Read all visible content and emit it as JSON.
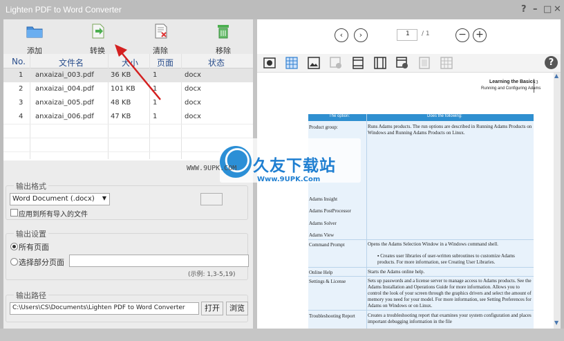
{
  "window": {
    "title": "Lighten PDF to Word Converter",
    "controls": [
      "?",
      "–",
      "□",
      "✕"
    ]
  },
  "toolbar": {
    "add": "添加",
    "convert": "转换",
    "clear": "清除",
    "remove": "移除"
  },
  "table": {
    "headers": [
      "No.",
      "文件名",
      "大小",
      "页面",
      "状态"
    ],
    "rows": [
      [
        "1",
        "anxaizai_003.pdf",
        "36 KB",
        "1",
        "docx"
      ],
      [
        "2",
        "anxaizai_004.pdf",
        "101 KB",
        "1",
        "docx"
      ],
      [
        "3",
        "anxaizai_005.pdf",
        "48 KB",
        "1",
        "docx"
      ],
      [
        "4",
        "anxaizai_006.pdf",
        "47 KB",
        "1",
        "docx"
      ]
    ]
  },
  "output_format": {
    "label": "输出格式",
    "selected": "Word Document (.docx)",
    "apply_all": "应用到所有导入的文件"
  },
  "output_settings": {
    "label": "输出设置",
    "all_pages": "所有页面",
    "some_pages": "选择部分页面",
    "example": "(示例: 1,3-5,19)"
  },
  "output_path": {
    "label": "输出路径",
    "value": "C:\\Users\\CS\\Documents\\Lighten PDF to Word Converter",
    "open": "打开",
    "browse": "浏览"
  },
  "viewer": {
    "page_current": "1",
    "page_total": "/ 1",
    "help": "?"
  },
  "document": {
    "header_title": "Learning the Basics",
    "header_page": "3",
    "header_sub": "Running and Configuring Adams",
    "col1": "The option:",
    "col2": "Does the following:",
    "rows": [
      {
        "label": "Product group:",
        "text": "Runs Adams products. The run options are described in Running Adams Products on Windows and Running Adams Products on Linux."
      },
      {
        "label": "Adams Insight",
        "text": ""
      },
      {
        "label": "Adams PostProcessor",
        "text": ""
      },
      {
        "label": "Adams Solver",
        "text": ""
      },
      {
        "label": "Adams View",
        "text": ""
      },
      {
        "label": "Command Prompt",
        "text": "Opens the Adams Selection Window in a Windows command shell."
      },
      {
        "label": "",
        "text": "▪ Creates user libraries of user-written subroutines to customize Adams products. For more information, see Creating User Libraries."
      },
      {
        "label": "Online Help",
        "text": "Starts the Adams online help."
      },
      {
        "label": "Settings & License",
        "text": "Sets up passwords and a license server to manage access to Adams products. See the Adams Installation and Operations Guide for more information. Allows you to control the look of your screen through the graphics drivers and select the amount of memory you need for your model. For more information, see Setting Preferences for Adams on Windows or on Linux."
      },
      {
        "label": "Troubleshooting Report",
        "text": "Creates a troubleshooting report that examines your system configuration and places important debugging information in the file"
      }
    ]
  },
  "watermark": {
    "www": "WWW.9UPK.COM",
    "brand": "久友下载站",
    "url": "Www.9UPK.Com"
  },
  "colors": {
    "accent": "#2f8fd0",
    "arrow": "#d42020",
    "titlebar": "#bcbcbc"
  }
}
